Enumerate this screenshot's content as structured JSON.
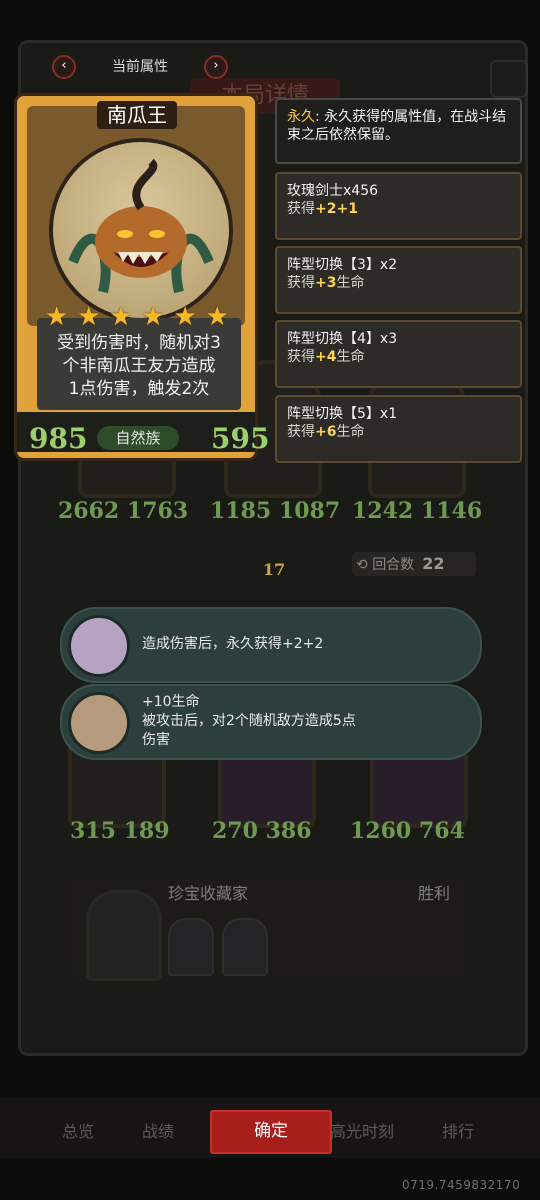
{
  "header": {
    "label": "当前属性",
    "prev_icon": "chevron-left-icon",
    "next_icon": "chevron-right-icon",
    "prev_glyph": "‹",
    "next_glyph": "›"
  },
  "unit_card": {
    "name": "南瓜王",
    "stars": 6,
    "description_lines": [
      "受到伤害时，随机对3",
      "个非南瓜王友方造成",
      "1点伤害，触发2次"
    ],
    "attack": "985",
    "health": "595",
    "tribe": "自然族"
  },
  "info_panels": [
    {
      "keyword": "永久",
      "text": ": 永久获得的属性值，在战斗结束之后依然保留。"
    },
    {
      "title": "玫瑰剑士x456",
      "gain_prefix": "获得",
      "gain_value": "+2+1",
      "gain_suffix": ""
    },
    {
      "title": "阵型切换【3】x2",
      "gain_prefix": "获得",
      "gain_value": "+3",
      "gain_suffix": "生命"
    },
    {
      "title": "阵型切换【4】x3",
      "gain_prefix": "获得",
      "gain_value": "+4",
      "gain_suffix": "生命"
    },
    {
      "title": "阵型切换【5】x1",
      "gain_prefix": "获得",
      "gain_value": "+6",
      "gain_suffix": "生命"
    }
  ],
  "board": {
    "row1_stats": [
      "2662 1763",
      "1185 1087",
      "1242 1146"
    ],
    "row2_stats": [
      "315 189",
      "270 386",
      "1260 764"
    ],
    "level": "17",
    "round_label": "回合数",
    "round_value": "22"
  },
  "abilities": [
    {
      "lines": [
        "造成伤害后，永久获得+2+2"
      ]
    },
    {
      "lines": [
        "+10生命",
        "被攻击后，对2个随机敌方造成5点",
        "伤害"
      ]
    }
  ],
  "collector": {
    "name": "珍宝收藏家",
    "result": "胜利"
  },
  "bottom_bar": {
    "tabs": [
      "总览",
      "战绩",
      "高光时刻",
      "排行"
    ],
    "confirm_label": "确定"
  },
  "uid": "0719.7459832170"
}
